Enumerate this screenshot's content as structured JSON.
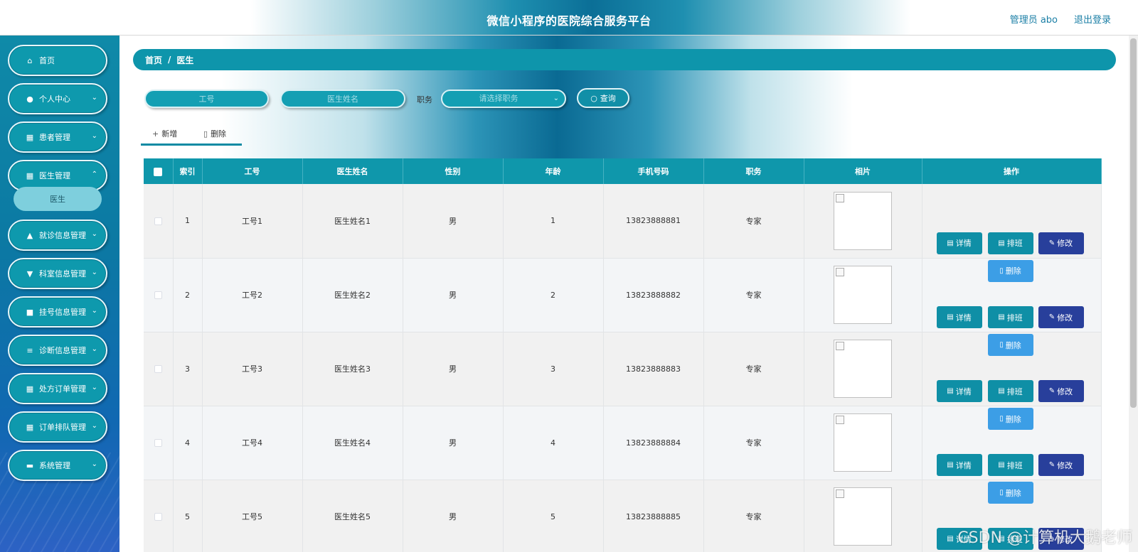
{
  "header": {
    "title": "微信小程序的医院综合服务平台",
    "user": "管理员 abo",
    "logout": "退出登录"
  },
  "sidebar": {
    "items": [
      {
        "label": "首页",
        "icon": "home-icon"
      },
      {
        "label": "个人中心",
        "icon": "user-icon"
      },
      {
        "label": "患者管理",
        "icon": "grid-icon"
      },
      {
        "label": "医生管理",
        "icon": "grid-icon"
      },
      {
        "label": "就诊信息管理",
        "icon": "thumb-icon"
      },
      {
        "label": "科室信息管理",
        "icon": "flag-icon"
      },
      {
        "label": "挂号信息管理",
        "icon": "printer-icon"
      },
      {
        "label": "诊断信息管理",
        "icon": "sliders-icon"
      },
      {
        "label": "处方订单管理",
        "icon": "grid-icon"
      },
      {
        "label": "订单排队管理",
        "icon": "grid-icon"
      },
      {
        "label": "系统管理",
        "icon": "briefcase-icon"
      }
    ],
    "submenu": {
      "label": "医生"
    }
  },
  "breadcrumb": {
    "home": "首页",
    "sep": "/",
    "current": "医生"
  },
  "search": {
    "job_no_placeholder": "工号",
    "name_placeholder": "医生姓名",
    "duty_label": "职务",
    "duty_placeholder": "请选择职务",
    "query_label": "查询"
  },
  "toolbar": {
    "add_label": "新增",
    "delete_label": "删除"
  },
  "table": {
    "headers": [
      "索引",
      "工号",
      "医生姓名",
      "性别",
      "年龄",
      "手机号码",
      "职务",
      "相片",
      "操作"
    ],
    "rows": [
      {
        "index": "1",
        "job_no": "工号1",
        "name": "医生姓名1",
        "gender": "男",
        "age": "1",
        "phone": "13823888881",
        "duty": "专家"
      },
      {
        "index": "2",
        "job_no": "工号2",
        "name": "医生姓名2",
        "gender": "男",
        "age": "2",
        "phone": "13823888882",
        "duty": "专家"
      },
      {
        "index": "3",
        "job_no": "工号3",
        "name": "医生姓名3",
        "gender": "男",
        "age": "3",
        "phone": "13823888883",
        "duty": "专家"
      },
      {
        "index": "4",
        "job_no": "工号4",
        "name": "医生姓名4",
        "gender": "男",
        "age": "4",
        "phone": "13823888884",
        "duty": "专家"
      },
      {
        "index": "5",
        "job_no": "工号5",
        "name": "医生姓名5",
        "gender": "男",
        "age": "5",
        "phone": "13823888885",
        "duty": "专家"
      }
    ],
    "actions": {
      "detail": "详情",
      "schedule": "排班",
      "edit": "修改",
      "delete": "删除"
    }
  },
  "watermark": "CSDN @计算机大鹅老师",
  "colors": {
    "primary": "#0f97ab",
    "edit_button": "#283f9b",
    "delete_button": "#3c9ee6"
  }
}
